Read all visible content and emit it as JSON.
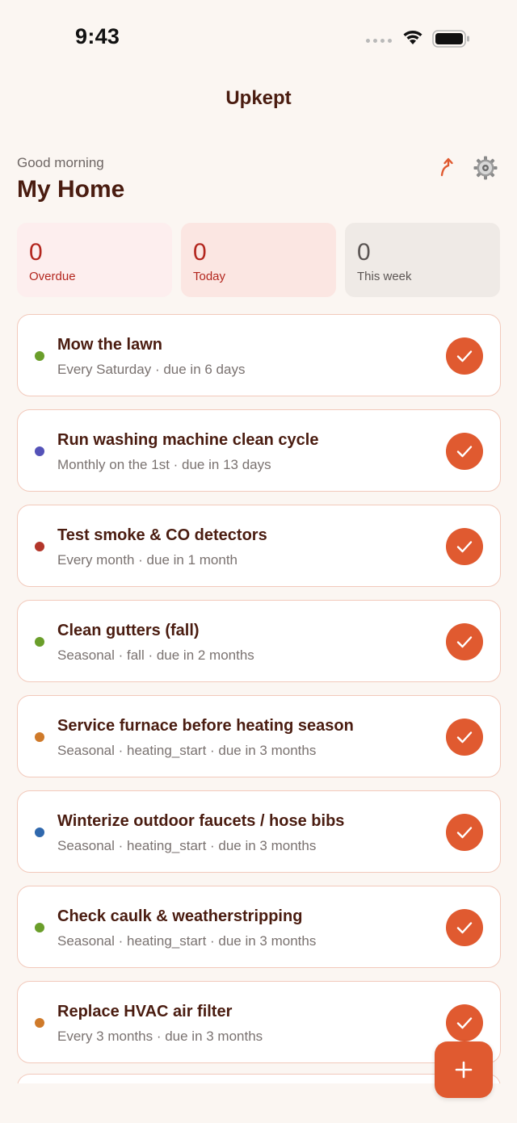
{
  "status_bar": {
    "time": "9:43"
  },
  "nav": {
    "title": "Upkept"
  },
  "header": {
    "greeting": "Good morning",
    "home_name": "My Home"
  },
  "stats": {
    "overdue": {
      "value": "0",
      "label": "Overdue"
    },
    "today": {
      "value": "0",
      "label": "Today"
    },
    "week": {
      "value": "0",
      "label": "This week"
    }
  },
  "colors": {
    "accent": "#e05a30",
    "green": "#6a9e2a",
    "purple": "#5452b8",
    "red": "#b3362a",
    "orange": "#cf7a2a",
    "blue": "#2f68ad"
  },
  "tasks": [
    {
      "title": "Mow the lawn",
      "subtitle": "Every Saturday · due in 6 days",
      "dot_color": "#6a9e2a"
    },
    {
      "title": "Run washing machine clean cycle",
      "subtitle": "Monthly on the 1st · due in 13 days",
      "dot_color": "#5452b8"
    },
    {
      "title": "Test smoke & CO detectors",
      "subtitle": "Every month · due in 1 month",
      "dot_color": "#b3362a"
    },
    {
      "title": "Clean gutters (fall)",
      "subtitle": "Seasonal · fall · due in 2 months",
      "dot_color": "#6a9e2a"
    },
    {
      "title": "Service furnace before heating season",
      "subtitle": "Seasonal · heating_start · due in 3 months",
      "dot_color": "#cf7a2a"
    },
    {
      "title": "Winterize outdoor faucets / hose bibs",
      "subtitle": "Seasonal · heating_start · due in 3 months",
      "dot_color": "#2f68ad"
    },
    {
      "title": "Check caulk & weatherstripping",
      "subtitle": "Seasonal · heating_start · due in 3 months",
      "dot_color": "#6a9e2a"
    },
    {
      "title": "Replace HVAC air filter",
      "subtitle": "Every 3 months · due in 3 months",
      "dot_color": "#cf7a2a"
    }
  ],
  "icons": {
    "share": "share-icon",
    "settings": "gear-icon",
    "check": "checkmark-icon",
    "add": "plus-icon"
  }
}
